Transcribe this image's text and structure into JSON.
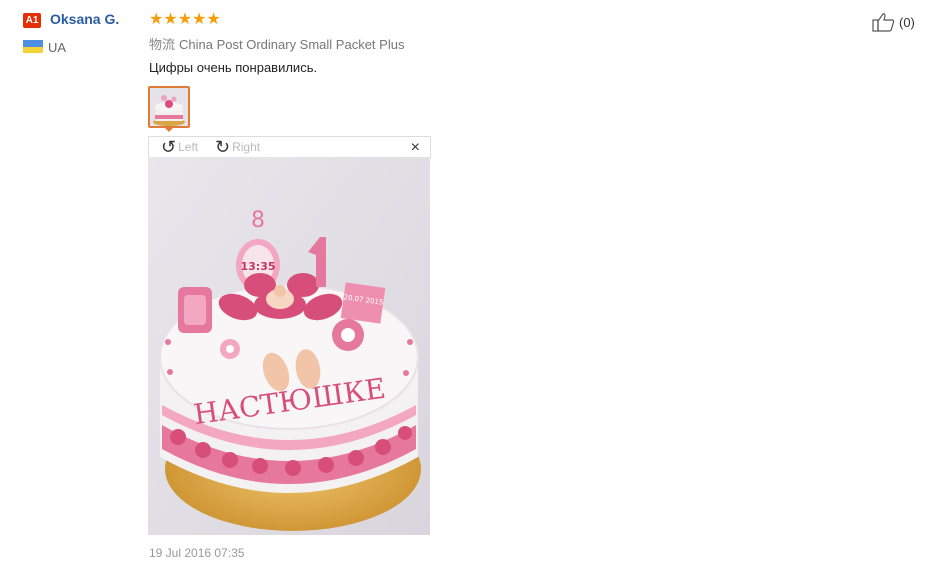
{
  "review": {
    "user_badge": "A1",
    "username": "Oksana G.",
    "country": "UA",
    "rating_stars": 5,
    "stars_glyphs": "★★★★★",
    "shipping_label": "物流",
    "shipping_method": "China Post Ordinary Small Packet Plus",
    "text": "Цифры очень понравились.",
    "date": "19 Jul 2016 07:35",
    "likes": "(0)"
  },
  "viewer": {
    "rotate_left_label": "Left",
    "rotate_right_label": "Right",
    "close_glyph": "×"
  },
  "cake": {
    "clock_text": "13:35",
    "name_text": "НАСТЮШКЕ",
    "cert_text": "20.07 2015",
    "accent_pink": "#d84e7a",
    "light_pink": "#f3a7c0",
    "board_gold": "#d9a646"
  },
  "colors": {
    "username": "#2a5d9f",
    "stars": "#f79c0a",
    "thumb_border": "#e07b39",
    "badge_bg": "#e62e04"
  }
}
